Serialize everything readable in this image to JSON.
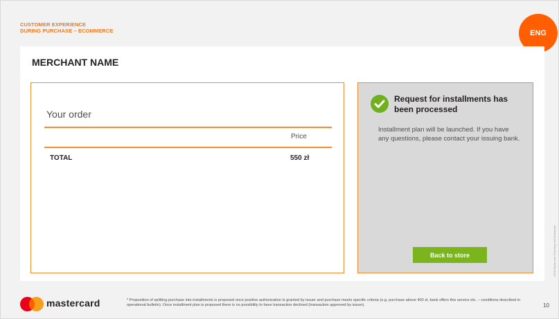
{
  "header": {
    "title_line1": "CUSTOMER EXPERIENCE",
    "title_line2": "DURING PURCHASE – ECOMMERCE",
    "language": "ENG"
  },
  "merchant": {
    "name": "MERCHANT NAME"
  },
  "order": {
    "title": "Your order",
    "price_header": "Price",
    "total_label": "TOTAL",
    "total_value": "550 zł"
  },
  "status": {
    "title": "Request for installments has been processed",
    "message": "Installment plan will be launched. If you have any questions, please contact your issuing bank.",
    "button_label": "Back to store",
    "icon": "check-circle-icon"
  },
  "footer": {
    "brand": "mastercard",
    "footnote": "* Proposition of splitting purchase into installments is proposed once positive authorization is granted by issuer and purchase meets specific criteria (e.g. purchase above 400 zł, bank offers this service etc. – conditions described in operational bulletin). Once installment plan is proposed there is no possibility to have transaction declined (transaction approved by issuer).",
    "page_number": "10",
    "copyright": "©2018 Mastercard. Proprietary and Confidential."
  },
  "colors": {
    "accent_orange": "#f28b30",
    "badge_orange": "#ff5f00",
    "button_green": "#7ab51d",
    "check_green": "#6fb01e",
    "mc_red": "#eb001b",
    "mc_yellow": "#f79e1b"
  }
}
